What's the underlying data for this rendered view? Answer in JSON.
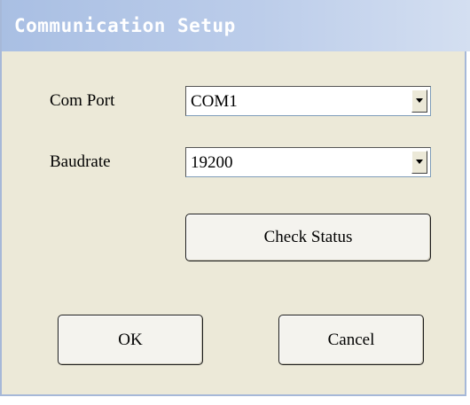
{
  "window": {
    "title": "Communication Setup"
  },
  "form": {
    "com_port_label": "Com Port",
    "com_port_value": "COM1",
    "baudrate_label": "Baudrate",
    "baudrate_value": "19200"
  },
  "buttons": {
    "check_status": "Check Status",
    "ok": "OK",
    "cancel": "Cancel"
  },
  "colors": {
    "title_bar_start": "#a9bfe3",
    "title_bar_end": "#d4dff1",
    "dialog_background": "#ece9d8"
  },
  "icons": {
    "dropdown": "chevron-down-icon"
  }
}
